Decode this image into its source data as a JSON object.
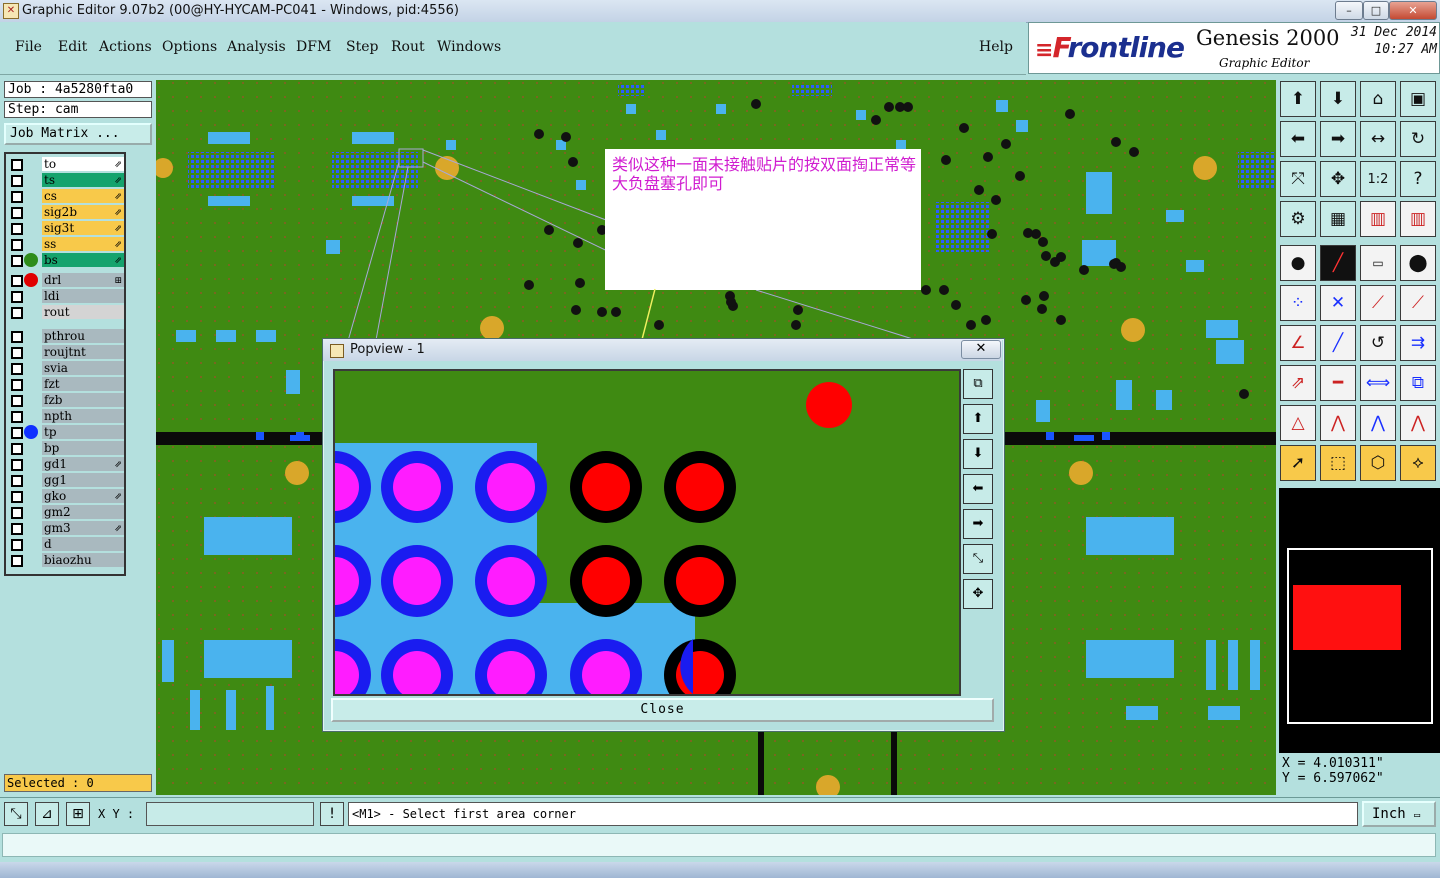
{
  "window": {
    "title": "Graphic Editor 9.07b2 (00@HY-HYCAM-PC041 - Windows, pid:4556)",
    "minimize": "–",
    "maximize": "□",
    "close": "✕"
  },
  "menu": {
    "file": "File",
    "edit": "Edit",
    "actions": "Actions",
    "options": "Options",
    "analysis": "Analysis",
    "dfm": "DFM",
    "step": "Step",
    "rout": "Rout",
    "windows": "Windows",
    "help": "Help"
  },
  "logo": {
    "brand_prefix": "F",
    "brand_rest": "rontline",
    "product": "Genesis 2000",
    "subtitle": "Graphic Editor",
    "date": "31 Dec 2014",
    "time": "10:27 AM"
  },
  "job": {
    "job_text": "Job : 4a5280fta0",
    "step_text": "Step: cam",
    "matrix_button": "Job Matrix ..."
  },
  "layers": [
    {
      "name": "to",
      "color": "#ffffff",
      "dot": "",
      "arrow": "⇗"
    },
    {
      "name": "ts",
      "color": "#15a36d",
      "dot": "",
      "arrow": "⇗"
    },
    {
      "name": "cs",
      "color": "#f8c94a",
      "dot": "",
      "arrow": "⇗"
    },
    {
      "name": "sig2b",
      "color": "#f8c94a",
      "dot": "",
      "arrow": "⇗"
    },
    {
      "name": "sig3t",
      "color": "#f8c94a",
      "dot": "",
      "arrow": "⇗"
    },
    {
      "name": "ss",
      "color": "#f8c94a",
      "dot": "",
      "arrow": "⇗"
    },
    {
      "name": "bs",
      "color": "#15a36d",
      "dot": "#2e8c1a",
      "arrow": "⇗"
    },
    {
      "name": "drl",
      "color": "#a9b9bf",
      "dot": "#e00000",
      "arrow": "⊞"
    },
    {
      "name": "ldi",
      "color": "#a9b9bf",
      "dot": "",
      "arrow": ""
    },
    {
      "name": "rout",
      "color": "#d4d4d4",
      "dot": "",
      "arrow": ""
    },
    {
      "name": "pthrou",
      "color": "#a9b9bf",
      "dot": "",
      "arrow": ""
    },
    {
      "name": "roujtnt",
      "color": "#a9b9bf",
      "dot": "",
      "arrow": ""
    },
    {
      "name": "svia",
      "color": "#a9b9bf",
      "dot": "",
      "arrow": ""
    },
    {
      "name": "fzt",
      "color": "#a9b9bf",
      "dot": "",
      "arrow": ""
    },
    {
      "name": "fzb",
      "color": "#a9b9bf",
      "dot": "",
      "arrow": ""
    },
    {
      "name": "npth",
      "color": "#a9b9bf",
      "dot": "",
      "arrow": ""
    },
    {
      "name": "tp",
      "color": "#a9b9bf",
      "dot": "#1030ff",
      "arrow": ""
    },
    {
      "name": "bp",
      "color": "#a9b9bf",
      "dot": "",
      "arrow": ""
    },
    {
      "name": "gd1",
      "color": "#a9b9bf",
      "dot": "",
      "arrow": "⇗"
    },
    {
      "name": "gg1",
      "color": "#a9b9bf",
      "dot": "",
      "arrow": ""
    },
    {
      "name": "gko",
      "color": "#a9b9bf",
      "dot": "",
      "arrow": "⇗"
    },
    {
      "name": "gm2",
      "color": "#a9b9bf",
      "dot": "",
      "arrow": ""
    },
    {
      "name": "gm3",
      "color": "#a9b9bf",
      "dot": "",
      "arrow": "⇗"
    },
    {
      "name": "d",
      "color": "#a9b9bf",
      "dot": "",
      "arrow": ""
    },
    {
      "name": "biaozhu",
      "color": "#a9b9bf",
      "dot": "",
      "arrow": ""
    }
  ],
  "selected": "Selected : 0",
  "annotation": {
    "text": "类似这种一面未接触贴片的按双面掏正常等大负盘塞孔即可"
  },
  "popview": {
    "title": "Popview - 1",
    "close_x": "✕",
    "close_button": "Close"
  },
  "coords": {
    "x_label": "X = 4.010311\"",
    "y_label": "Y = 6.597062\""
  },
  "bottom": {
    "xy_label": "X Y :",
    "prompt_icon": "!",
    "prompt": "<M1> - Select first area corner",
    "unit": "Inch"
  }
}
